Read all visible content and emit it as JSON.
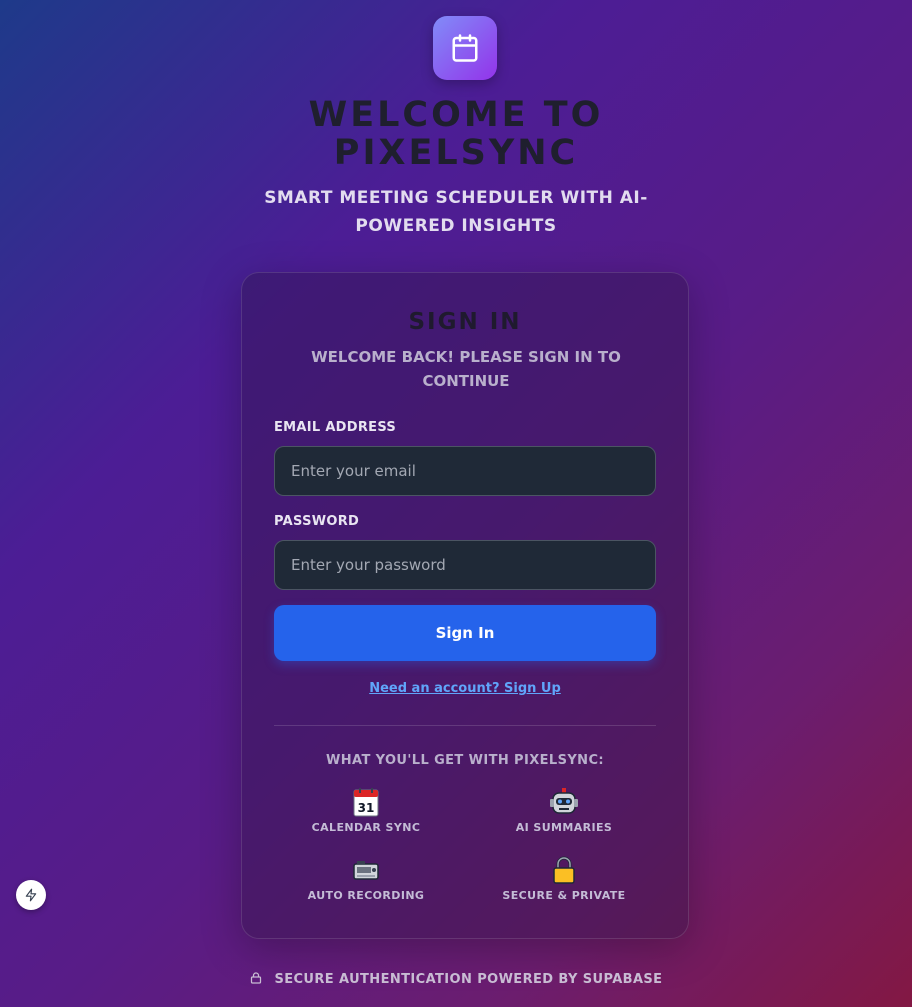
{
  "header": {
    "title_line1": "WELCOME TO",
    "title_line2": "PIXELSYNC",
    "subtitle_line1": "SMART MEETING SCHEDULER WITH AI-",
    "subtitle_line2": "POWERED INSIGHTS",
    "logo_icon": "calendar-icon"
  },
  "card": {
    "title": "SIGN IN",
    "subtitle_line1": "WELCOME BACK! PLEASE SIGN IN TO",
    "subtitle_line2": "CONTINUE",
    "email_label": "EMAIL ADDRESS",
    "email_placeholder": "Enter your email",
    "email_value": "",
    "password_label": "PASSWORD",
    "password_placeholder": "Enter your password",
    "password_value": "",
    "signin_label": "Sign In",
    "signup_link": "Need an account? Sign Up",
    "features_title": "WHAT YOU'LL GET WITH PIXELSYNC:",
    "features": [
      {
        "label": "CALENDAR SYNC",
        "icon": "calendar-icon"
      },
      {
        "label": "AI SUMMARIES",
        "icon": "robot-icon"
      },
      {
        "label": "AUTO RECORDING",
        "icon": "video-recorder-icon"
      },
      {
        "label": "SECURE & PRIVATE",
        "icon": "lock-icon"
      }
    ]
  },
  "footer": {
    "text": "SECURE AUTHENTICATION POWERED BY SUPABASE",
    "icon": "lock-icon"
  },
  "floating": {
    "icon": "lightning-bolt-icon"
  },
  "colors": {
    "primary_button": "#2563eb",
    "link": "#60a5fa",
    "input_bg": "#1f2937",
    "logo_gradient_start": "#818cf8",
    "logo_gradient_end": "#9333ea"
  }
}
